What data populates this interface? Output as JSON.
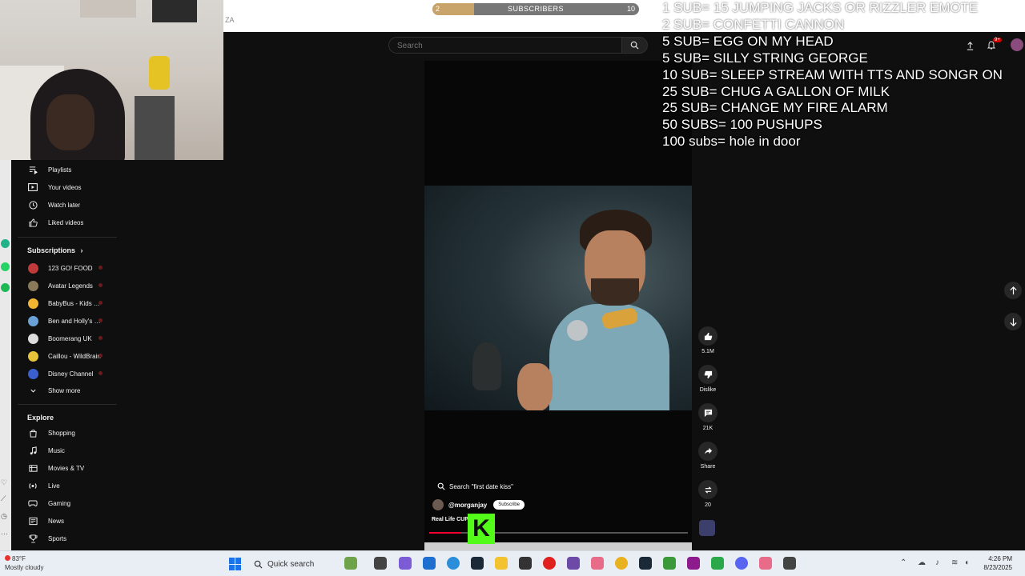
{
  "stream_overlay": {
    "goals": [
      "1 SUB= 15 JUMPING JACKS OR RIZZLER EMOTE",
      "2 SUB= CONFETTI CANNON",
      "5 SUB= EGG ON MY HEAD",
      "5 SUB= SILLY STRING GEORGE",
      "10 SUB= SLEEP STREAM WITH TTS AND SONGR ON",
      "25 SUB= CHUG A GALLON OF MILK",
      "25 SUB= CHANGE MY FIRE ALARM",
      "50 SUBS= 100 PUSHUPS",
      "100 subs= hole in door"
    ],
    "subscriber_goal": {
      "label": "SUBSCRIBERS",
      "current": "2",
      "target": "10",
      "progress_fraction": 0.2
    },
    "browser_tab_fragment": "ZA",
    "kick_logo_letter": "K"
  },
  "youtube": {
    "search": {
      "placeholder": "Search"
    },
    "notification_count": "9+",
    "sidebar": {
      "you_items": [
        {
          "label": "Playlists",
          "icon": "playlists-icon"
        },
        {
          "label": "Your videos",
          "icon": "your-videos-icon"
        },
        {
          "label": "Watch later",
          "icon": "clock-icon"
        },
        {
          "label": "Liked videos",
          "icon": "thumbs-up-icon"
        }
      ],
      "subscriptions_heading": "Subscriptions",
      "subscriptions": [
        {
          "label": "123 GO! FOOD",
          "color": "#c0393b"
        },
        {
          "label": "Avatar Legends",
          "color": "#8a7a5a"
        },
        {
          "label": "BabyBus - Kids S...",
          "color": "#f2b533"
        },
        {
          "label": "Ben and Holly's L...",
          "color": "#6aa2d8"
        },
        {
          "label": "Boomerang UK",
          "color": "#dddddd"
        },
        {
          "label": "Caillou - WildBrain",
          "color": "#e9c43a"
        },
        {
          "label": "Disney Channel",
          "color": "#3b5fcf"
        }
      ],
      "show_more": "Show more",
      "explore_heading": "Explore",
      "explore": [
        {
          "label": "Shopping",
          "icon": "shopping-bag-icon"
        },
        {
          "label": "Music",
          "icon": "music-note-icon"
        },
        {
          "label": "Movies & TV",
          "icon": "film-icon"
        },
        {
          "label": "Live",
          "icon": "live-icon"
        },
        {
          "label": "Gaming",
          "icon": "gaming-icon"
        },
        {
          "label": "News",
          "icon": "news-icon"
        },
        {
          "label": "Sports",
          "icon": "trophy-icon"
        }
      ]
    },
    "short": {
      "search_hint": "Search \"first date kiss\"",
      "channel": "@morganjay",
      "subscribe": "Subscribe",
      "title": "Real Life CUP",
      "progress_fraction": 0.12,
      "likes": "5.1M",
      "dislike_label": "Dislike",
      "comments": "21K",
      "share_label": "Share",
      "remix_count": "20"
    }
  },
  "taskbar": {
    "weather_temp": "83°F",
    "weather_desc": "Mostly cloudy",
    "search_label": "Quick search",
    "time": "4:26 PM",
    "date": "8/23/2025"
  }
}
